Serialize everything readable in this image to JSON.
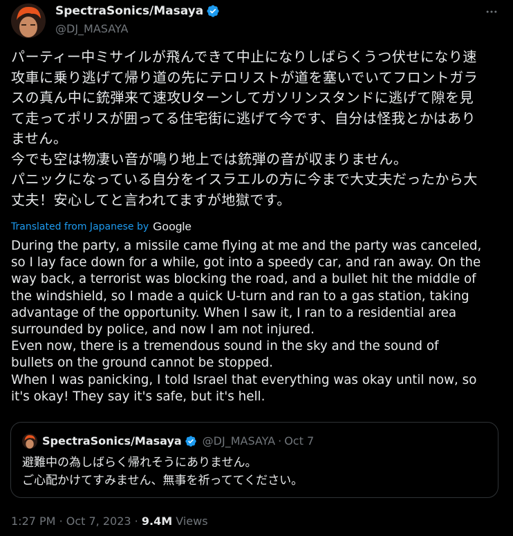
{
  "author": {
    "display_name": "SpectraSonics/Masaya",
    "handle": "@DJ_MASAYA",
    "verified_icon": "verified-badge-icon",
    "avatar_colors": {
      "hair": "#e8531d",
      "skin": "#c98a63",
      "bg": "#2a1a14"
    }
  },
  "more_icon": "more-horizontal-icon",
  "tweet": {
    "japanese_text": "パーティー中ミサイルが飛んできて中止になりしばらくうつ伏せになり速\n攻車に乗り逃げて帰り道の先にテロリストが道を塞いでいてフロントガラ\nスの真ん中に銃弾来て速攻Uターンしてガソリンスタンドに逃げて隙を見\nて走ってポリスが囲ってる住宅街に逃げて今です、自分は怪我とかはあり\nません。\n今でも空は物凄い音が鳴り地上では銃弾の音が収まりません。\nパニックになっている自分をイスラエルの方に今まで大丈夫だったから大\n丈夫！安心してと言われてますが地獄です。",
    "translated_label": "Translated from Japanese by",
    "translator": "Google",
    "english_text": "During the party, a missile came flying at me and the party was canceled,\nso I lay face down for a while, got into a speedy car, and ran away. On the\nway back, a terrorist was blocking the road, and a bullet hit the middle of\nthe windshield, so I made a quick U-turn and ran to a gas station, taking\nadvantage of the opportunity. When I saw it, I ran to a residential area\nsurrounded by police, and now I am not injured.\nEven now, there is a tremendous sound in the sky and the sound of\nbullets on the ground cannot be stopped.\nWhen I was panicking, I told Israel that everything was okay until now, so\nit's okay! They say it's safe, but it's hell."
  },
  "quoted_tweet": {
    "display_name": "SpectraSonics/Masaya",
    "handle": "@DJ_MASAYA",
    "separator": "·",
    "date": "Oct 7",
    "text": "避難中の為しばらく帰れそうにありません。\nご心配かけてすみません、無事を祈っててください。"
  },
  "meta": {
    "time": "1:27 PM",
    "separator": "·",
    "date": "Oct 7, 2023",
    "views_count": "9.4M",
    "views_label": "Views"
  },
  "colors": {
    "background": "#000000",
    "text_primary": "#e7e9ea",
    "text_secondary": "#71767b",
    "accent_blue": "#1d9bf0",
    "border": "#2f3336"
  }
}
